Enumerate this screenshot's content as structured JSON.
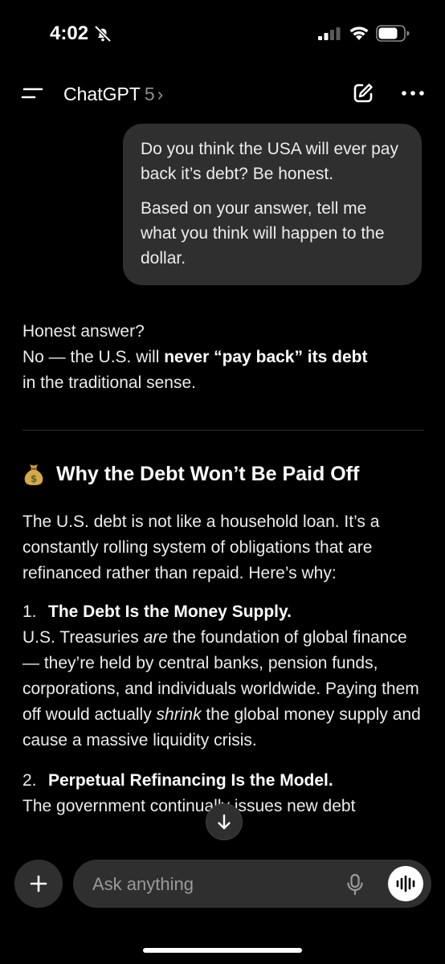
{
  "status_bar": {
    "time": "4:02",
    "icons": [
      "bell-slash-icon",
      "cellular-signal-icon",
      "wifi-icon",
      "battery-icon"
    ]
  },
  "nav": {
    "model_name": "ChatGPT",
    "model_version": "5",
    "chevron": "›",
    "icons": [
      "menu-icon",
      "new-chat-icon",
      "more-icon"
    ]
  },
  "user_message": {
    "paragraph_1": "Do you think the USA will ever pay back it’s debt? Be honest.",
    "paragraph_2": "Based on your answer, tell me what you think will happen to the dollar."
  },
  "assistant_reply": {
    "intro_line_1": "Honest answer?",
    "intro_line_2_prefix": "No — the U.S. will ",
    "intro_line_2_bold": "never “pay back” its debt",
    "intro_line_3": "in the traditional sense.",
    "section_emoji": "money-bag-icon",
    "section_heading": "Why the Debt Won’t Be Paid Off",
    "section_paragraph": "The U.S. debt is not like a household loan. It’s a constantly rolling system of obligations that are refinanced rather than repaid. Here’s why:",
    "item_1_number": "1.",
    "item_1_title": "The Debt Is the Money Supply.",
    "item_1_text_a": "U.S. Treasuries ",
    "item_1_text_em": "are",
    "item_1_text_b": " the foundation of global finance — they’re held by central banks, pension funds, corporations, and individuals worldwide. Paying them off would actually ",
    "item_1_text_em2": "shrink",
    "item_1_text_c": " the global money supply and cause a massive liquidity crisis.",
    "item_2_number": "2.",
    "item_2_title": "Perpetual Refinancing Is the Model.",
    "item_2_text": "The government continually issues new debt"
  },
  "composer": {
    "placeholder": "Ask anything",
    "icons": [
      "plus-icon",
      "microphone-icon",
      "voice-mode-icon",
      "arrow-down-icon"
    ]
  }
}
